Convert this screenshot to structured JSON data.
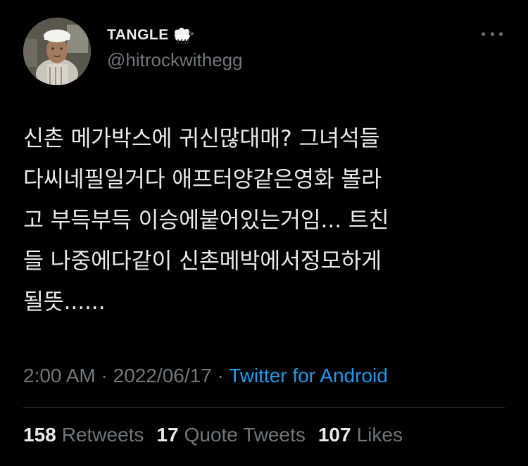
{
  "user": {
    "display_name": "TANGLE",
    "handle": "@hitrockwithegg",
    "name_emoji": "sheep-icon"
  },
  "tweet": {
    "lines": [
      "신촌 메가박스에 귀신많대매? 그녀석들",
      "다씨네필일거다 애프터양같은영화 볼라",
      "고 부득부득 이승에붙어있는거임... 트친",
      "들 나중에다같이 신촌메박에서정모하게",
      "될뜻......"
    ]
  },
  "meta": {
    "time": "2:00 AM",
    "sep1": " · ",
    "date": "2022/06/17",
    "sep2": " · ",
    "source": "Twitter for Android"
  },
  "stats": {
    "retweets_count": "158",
    "retweets_label": "Retweets",
    "quotes_count": "17",
    "quotes_label": "Quote Tweets",
    "likes_count": "107",
    "likes_label": "Likes"
  },
  "colors": {
    "background": "#000000",
    "text": "#e7e9ea",
    "secondary": "#71767b",
    "link": "#1d9bf0",
    "divider": "#2f3336"
  }
}
